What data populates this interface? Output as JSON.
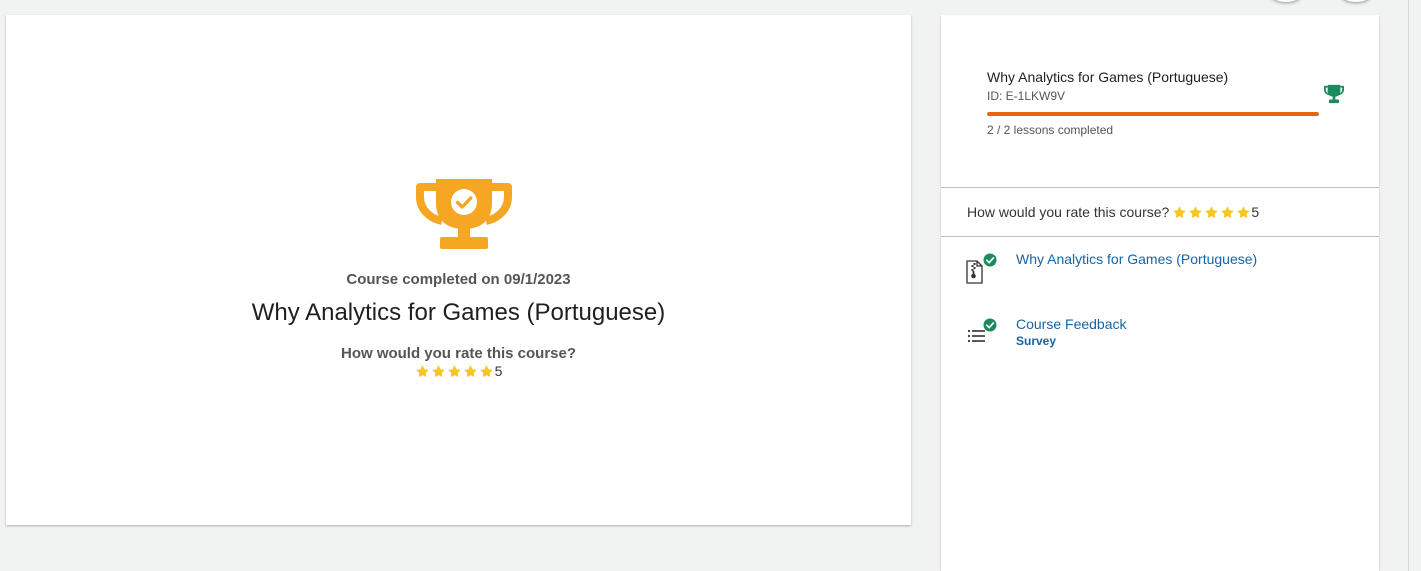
{
  "main": {
    "completed_text": "Course completed on 09/1/2023",
    "course_title": "Why Analytics for Games (Portuguese)",
    "rate_question": "How would you rate this course?",
    "rating_value": "5",
    "trophy_icon": "trophy-check-icon",
    "star_count": 5
  },
  "sidebar": {
    "course_title": "Why Analytics for Games (Portuguese)",
    "course_id": "ID: E-1LKW9V",
    "progress_fraction": 1.0,
    "lessons_completed": "2 / 2 lessons completed",
    "trophy_icon": "trophy-icon",
    "rate_question": "How would you rate this course?",
    "rating_value": "5",
    "items": [
      {
        "label": "Why Analytics for Games (Portuguese)",
        "subtitle": "",
        "icon": "document-zip-icon",
        "status_icon": "check-circle-icon"
      },
      {
        "label": "Course Feedback",
        "subtitle": "Survey",
        "icon": "list-icon",
        "status_icon": "check-circle-icon"
      }
    ]
  },
  "colors": {
    "trophy_orange": "#f5a623",
    "progress_orange": "#e5660f",
    "success_green": "#1c8a5d",
    "link_blue": "#1565a8",
    "star_yellow": "#f7c51d"
  }
}
